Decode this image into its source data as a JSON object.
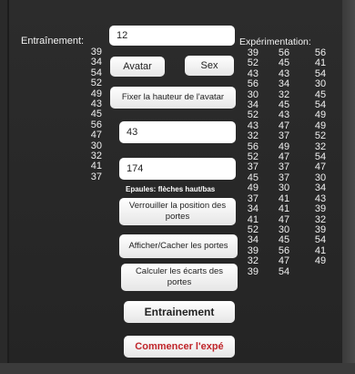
{
  "left_panel": {
    "title": "Entraînement:",
    "values": [
      "39",
      "34",
      "54",
      "52",
      "49",
      "43",
      "45",
      "56",
      "47",
      "30",
      "32",
      "41",
      "37"
    ]
  },
  "right_panel": {
    "title": "Expérimentation:",
    "col1": [
      "39",
      "52",
      "43",
      "56",
      "30",
      "34",
      "52",
      "43",
      "32",
      "56",
      "52",
      "37",
      "45",
      "49",
      "37",
      "34",
      "41",
      "52",
      "34",
      "39",
      "32",
      "39"
    ],
    "col2": [
      "56",
      "45",
      "43",
      "34",
      "32",
      "45",
      "43",
      "47",
      "37",
      "49",
      "47",
      "37",
      "37",
      "30",
      "41",
      "41",
      "47",
      "30",
      "45",
      "56",
      "47",
      "54"
    ],
    "col3": [
      "56",
      "41",
      "54",
      "30",
      "45",
      "54",
      "49",
      "49",
      "52",
      "32",
      "54",
      "47",
      "30",
      "34",
      "43",
      "39",
      "32",
      "39",
      "54",
      "41",
      "49"
    ]
  },
  "form": {
    "field_top": "12",
    "avatar_button": "Avatar",
    "sex_button": "Sex",
    "fix_height_button": "Fixer la hauteur de l'avatar",
    "field_43": "43",
    "field_174": "174",
    "note": "Epaules: flèches haut/bas",
    "lock_doors_button": "Verrouiller la position des portes",
    "toggle_doors_button": "Afficher/Cacher les portes",
    "compute_gaps_button": "Calculer les écarts des portes",
    "training_button": "Entrainement",
    "start_button": "Commencer l'expé"
  },
  "colors": {
    "start_button_text": "#c0262b"
  }
}
